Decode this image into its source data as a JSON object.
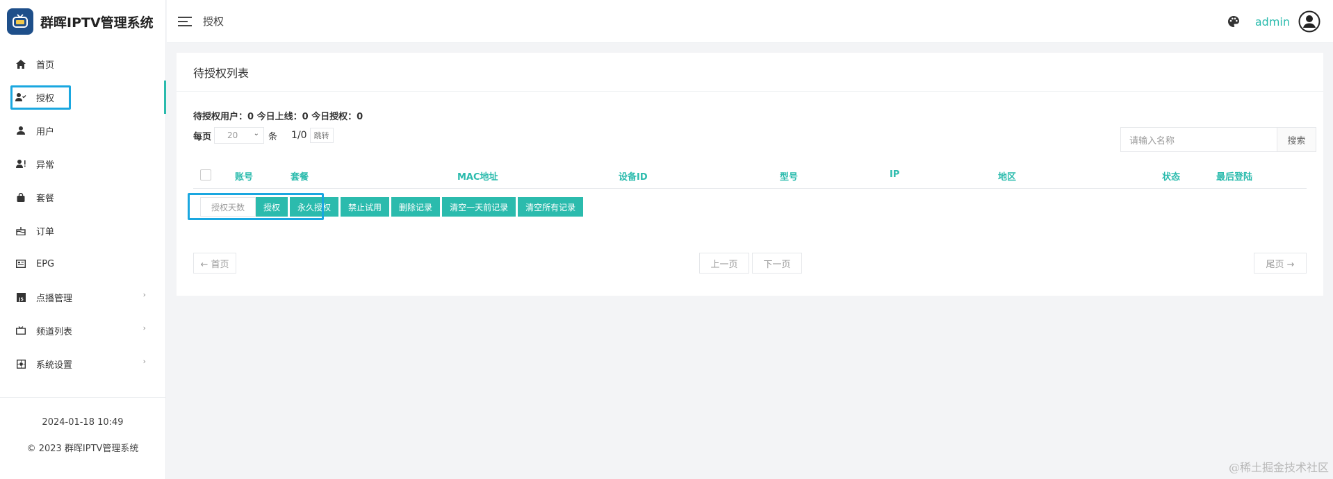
{
  "app": {
    "title": "群晖IPTV管理系统"
  },
  "sidebar": {
    "items": [
      {
        "label": "首页",
        "icon": "home-icon"
      },
      {
        "label": "授权",
        "icon": "user-check-icon"
      },
      {
        "label": "用户",
        "icon": "user-icon"
      },
      {
        "label": "异常",
        "icon": "user-alert-icon"
      },
      {
        "label": "套餐",
        "icon": "bag-icon"
      },
      {
        "label": "订单",
        "icon": "cake-icon"
      },
      {
        "label": "EPG",
        "icon": "guide-icon"
      },
      {
        "label": "点播管理",
        "icon": "js-icon",
        "arrow": "›"
      },
      {
        "label": "频道列表",
        "icon": "tv-icon",
        "arrow": "›"
      },
      {
        "label": "系统设置",
        "icon": "settings-icon",
        "arrow": "›"
      }
    ],
    "footer": {
      "datetime": "2024-01-18 10:49",
      "copyright": "© 2023 群晖IPTV管理系统"
    }
  },
  "topbar": {
    "breadcrumb": "授权",
    "username": "admin"
  },
  "card": {
    "title": "待授权列表",
    "stats": "待授权用户：0 今日上线：0 今日授权：0",
    "per_page_label": "每页",
    "per_page_value": "20",
    "per_page_unit": "条",
    "page_info": "1/0",
    "jump_label": "跳转",
    "search_placeholder": "请输入名称",
    "search_button": "搜索",
    "columns": [
      "账号",
      "套餐",
      "MAC地址",
      "设备ID",
      "型号",
      "IP",
      "地区",
      "状态",
      "最后登陆"
    ],
    "actions": {
      "days_placeholder": "授权天数",
      "authorize": "授权",
      "permanent": "永久授权",
      "ban_trial": "禁止试用",
      "delete_records": "删除记录",
      "clear_day_before": "清空一天前记录",
      "clear_all": "清空所有记录"
    },
    "pagination": {
      "first": "← 首页",
      "prev": "上一页",
      "next": "下一页",
      "last": "尾页 →"
    }
  },
  "watermark": "@稀土掘金技术社区",
  "colors": {
    "accent": "#2bbbad",
    "highlight": "#1aa7e0"
  }
}
